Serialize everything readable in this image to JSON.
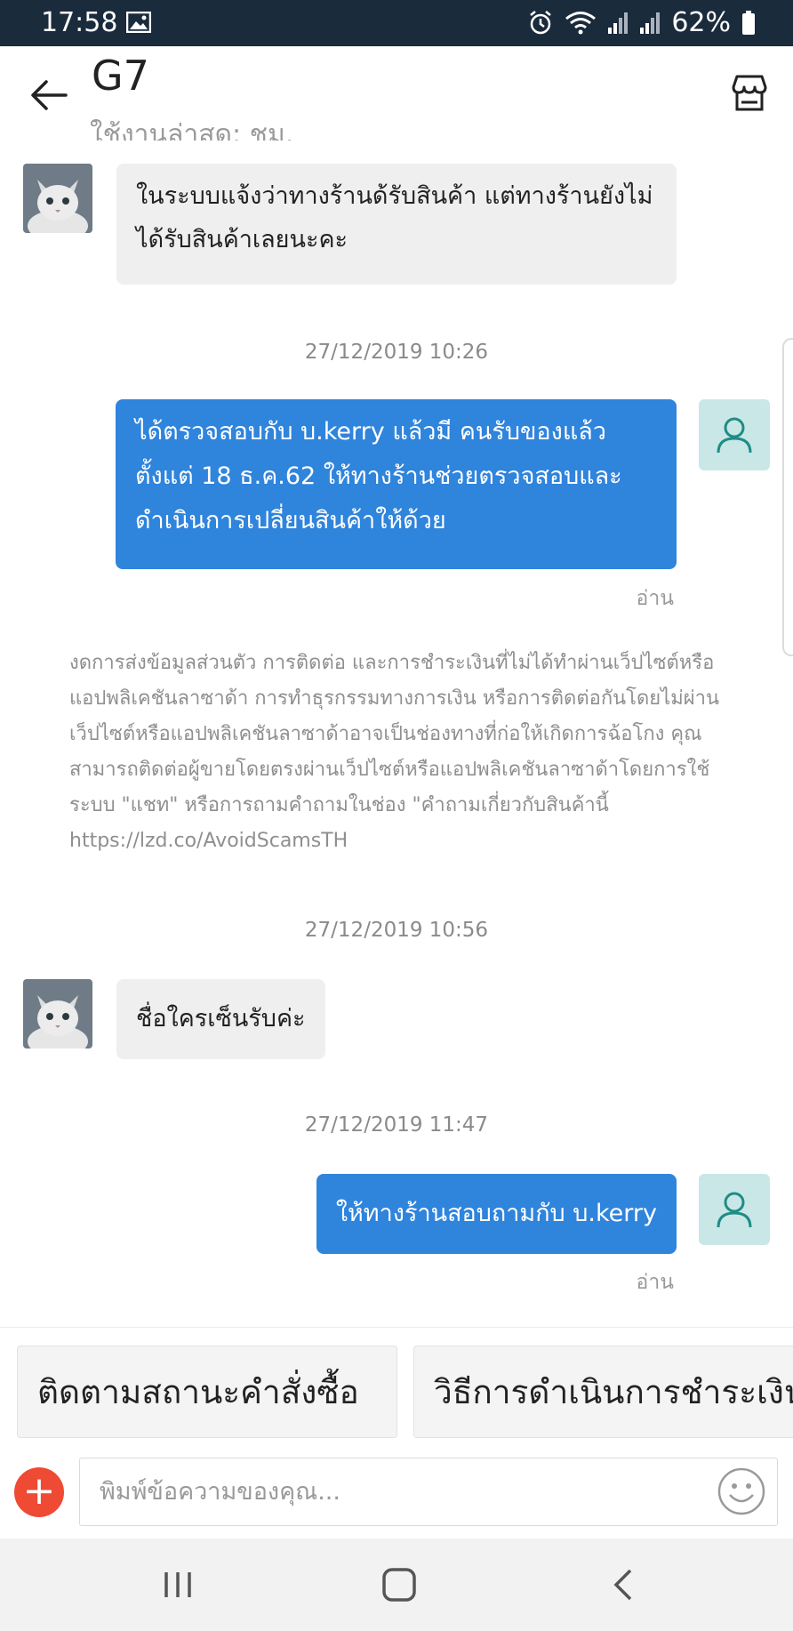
{
  "status_bar": {
    "time": "17:58",
    "battery": "62%"
  },
  "header": {
    "title": "G7",
    "subtitle": "ใช้งานล่าสุด: ชม."
  },
  "messages": [
    {
      "type": "incoming",
      "text": "ในระบบแจ้งว่าทางร้านด้รับสินค้า แต่ทางร้านยังไม่ได้รับสินค้าเลยนะคะ"
    },
    {
      "type": "timestamp",
      "text": "27/12/2019 10:26"
    },
    {
      "type": "outgoing",
      "text": "ได้ตรวจสอบกับ บ.kerry แล้วมี คนรับของแล้ว ตั้งแต่ 18 ธ.ค.62 ให้ทางร้านช่วยตรวจสอบและดำเนินการเปลี่ยนสินค้าให้ด้วย",
      "status": "อ่าน"
    },
    {
      "type": "notice",
      "text": "งดการส่งข้อมูลส่วนตัว การติดต่อ และการชำระเงินที่ไม่ได้ทำผ่านเว็ปไซต์หรือแอปพลิเคชันลาซาด้า การทำธุรกรรมทางการเงิน หรือการติดต่อกันโดยไม่ผ่านเว็ปไซต์หรือแอปพลิเคชันลาซาด้าอาจเป็นช่องทางที่ก่อให้เกิดการฉ้อโกง คุณสามารถติดต่อผู้ขายโดยตรงผ่านเว็ปไซต์หรือแอปพลิเคชันลาซาด้าโดยการใช้ระบบ \"แชท\" หรือการถามคำถามในช่อง \"คำถามเกี่ยวกับสินค้านี้ https://lzd.co/AvoidScamsTH"
    },
    {
      "type": "timestamp",
      "text": "27/12/2019 10:56"
    },
    {
      "type": "incoming",
      "text": "ชื่อใครเซ็นรับค่ะ"
    },
    {
      "type": "timestamp",
      "text": "27/12/2019 11:47"
    },
    {
      "type": "outgoing",
      "text": "ให้ทางร้านสอบถามกับ บ.kerry",
      "status": "อ่าน"
    }
  ],
  "quick_replies": [
    "ติดตามสถานะคำสั่งซื้อ",
    "วิธีการดำเนินการชำระเงิน"
  ],
  "input": {
    "placeholder": "พิมพ์ข้อความของคุณ..."
  },
  "icons": {
    "back": "arrow-left-icon",
    "store": "store-icon",
    "user": "user-icon",
    "add": "plus-icon",
    "emoji": "smiley-icon",
    "nav": [
      "recent-apps-icon",
      "home-icon",
      "back-nav-icon"
    ]
  },
  "colors": {
    "status_bar": "#1a2b3c",
    "outgoing_bubble": "#2f84dc",
    "incoming_bubble": "#efefef",
    "user_avatar_bg": "#c9e7e6",
    "plus_button": "#ef4a33"
  }
}
